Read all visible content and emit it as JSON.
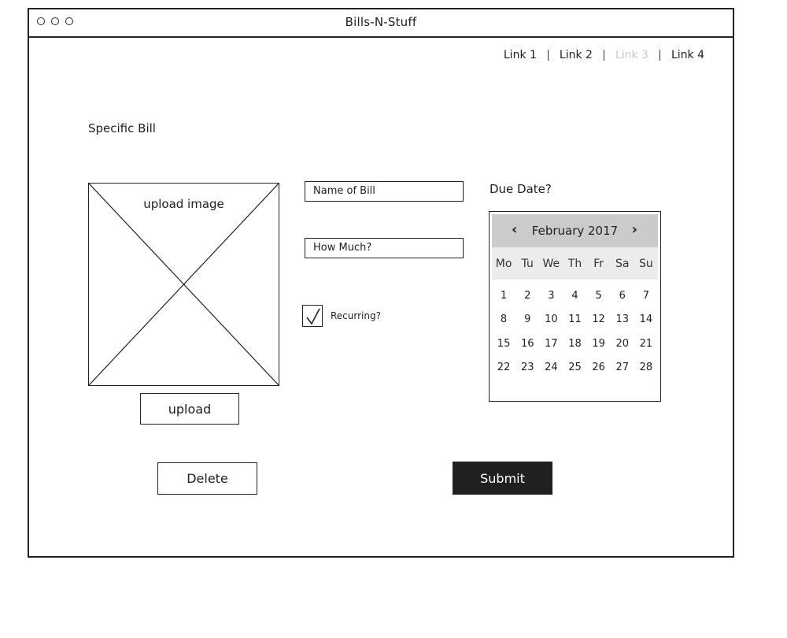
{
  "window": {
    "title": "Bills-N-Stuff"
  },
  "nav": {
    "links": [
      {
        "label": "Link 1",
        "disabled": false
      },
      {
        "label": "Link 2",
        "disabled": false
      },
      {
        "label": "Link 3",
        "disabled": true
      },
      {
        "label": "Link 4",
        "disabled": false
      }
    ]
  },
  "page": {
    "heading": "Specific Bill"
  },
  "image": {
    "placeholder_label": "upload image",
    "upload_button": "upload"
  },
  "form": {
    "name_placeholder": "Name of Bill",
    "amount_placeholder": "How Much?",
    "recurring_label": "Recurring?",
    "recurring_checked": true
  },
  "due": {
    "label": "Due Date?",
    "calendar": {
      "month_label": "February 2017",
      "prev_icon": "‹",
      "next_icon": "›",
      "weekdays": [
        "Mo",
        "Tu",
        "We",
        "Th",
        "Fr",
        "Sa",
        "Su"
      ],
      "days": [
        "1",
        "2",
        "3",
        "4",
        "5",
        "6",
        "7",
        "8",
        "9",
        "10",
        "11",
        "12",
        "13",
        "14",
        "15",
        "16",
        "17",
        "18",
        "19",
        "20",
        "21",
        "22",
        "23",
        "24",
        "25",
        "26",
        "27",
        "28"
      ]
    }
  },
  "actions": {
    "delete_label": "Delete",
    "submit_label": "Submit"
  }
}
